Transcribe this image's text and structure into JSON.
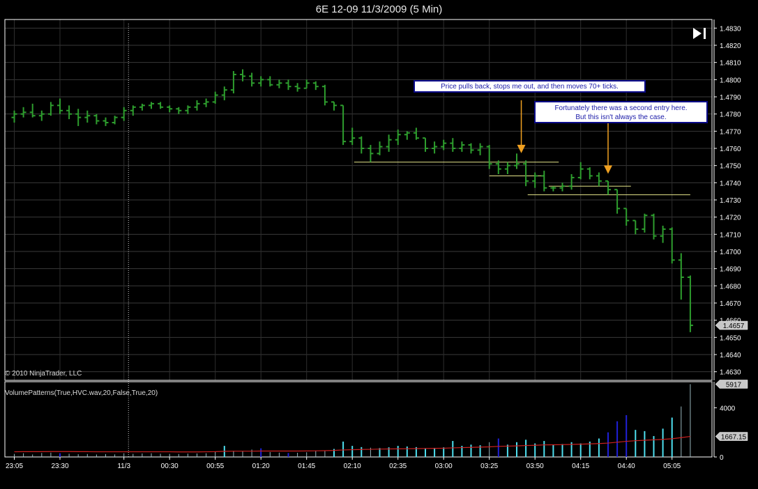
{
  "window": {
    "title": "6E 12-09  11/3/2009 (5 Min)"
  },
  "copyright": "© 2010 NinjaTrader, LLC",
  "indicator_label": "VolumePatterns(True,HVC.wav,20,False,True,20)",
  "annotations": [
    {
      "text": "Price pulls back, stops me out, and then moves 70+ ticks."
    },
    {
      "text": "Fortunately there was a second entry here.\nBut this isn't always the case."
    }
  ],
  "colors": {
    "price_bar": "#2e9e2e",
    "level_line": "#e6e68a",
    "volume_high": "#4ee0f0",
    "volume_low": "#2020d8",
    "volume_avg": "#cc2020",
    "arrow": "#f0a020"
  },
  "icons": {
    "nav": "skip-to-end-icon"
  },
  "chart_data": [
    {
      "type": "ohlc",
      "ylim": [
        1.4625,
        1.4835
      ],
      "yticks": [
        "1.4830",
        "1.4820",
        "1.4810",
        "1.4800",
        "1.4790",
        "1.4780",
        "1.4770",
        "1.4760",
        "1.4750",
        "1.4740",
        "1.4730",
        "1.4720",
        "1.4710",
        "1.4700",
        "1.4690",
        "1.4680",
        "1.4670",
        "1.4660",
        "1.4650",
        "1.4640",
        "1.4630"
      ],
      "last_price_label": "1.4657",
      "xticks": [
        {
          "label": "23:05",
          "i": 0
        },
        {
          "label": "23:30",
          "i": 5
        },
        {
          "label": "11/3",
          "i": 12
        },
        {
          "label": "00:30",
          "i": 17
        },
        {
          "label": "00:55",
          "i": 22
        },
        {
          "label": "01:20",
          "i": 27
        },
        {
          "label": "01:45",
          "i": 32
        },
        {
          "label": "02:10",
          "i": 37
        },
        {
          "label": "02:35",
          "i": 42
        },
        {
          "label": "03:00",
          "i": 47
        },
        {
          "label": "03:25",
          "i": 52
        },
        {
          "label": "03:50",
          "i": 57
        },
        {
          "label": "04:15",
          "i": 62
        },
        {
          "label": "04:40",
          "i": 67
        },
        {
          "label": "05:05",
          "i": 72
        }
      ],
      "session_break_index": 12.5,
      "bars": [
        [
          1.4778,
          1.4782,
          1.4775,
          1.478
        ],
        [
          1.478,
          1.4784,
          1.4778,
          1.4781
        ],
        [
          1.4781,
          1.4786,
          1.4778,
          1.4779
        ],
        [
          1.4779,
          1.4782,
          1.4776,
          1.478
        ],
        [
          1.478,
          1.4787,
          1.4779,
          1.4785
        ],
        [
          1.4785,
          1.4789,
          1.478,
          1.4782
        ],
        [
          1.4782,
          1.4785,
          1.4777,
          1.478
        ],
        [
          1.478,
          1.4783,
          1.4773,
          1.4778
        ],
        [
          1.4778,
          1.4782,
          1.4775,
          1.4779
        ],
        [
          1.4779,
          1.478,
          1.4774,
          1.4776
        ],
        [
          1.4776,
          1.4778,
          1.4773,
          1.4775
        ],
        [
          1.4775,
          1.4779,
          1.4774,
          1.4778
        ],
        [
          1.4778,
          1.4784,
          1.4776,
          1.4782
        ],
        [
          1.4782,
          1.4785,
          1.4779,
          1.4784
        ],
        [
          1.4784,
          1.4786,
          1.4782,
          1.4785
        ],
        [
          1.4785,
          1.4787,
          1.4783,
          1.4786
        ],
        [
          1.4786,
          1.4787,
          1.4783,
          1.4784
        ],
        [
          1.4784,
          1.4785,
          1.4781,
          1.4783
        ],
        [
          1.4783,
          1.4784,
          1.478,
          1.4782
        ],
        [
          1.4782,
          1.4785,
          1.478,
          1.4784
        ],
        [
          1.4784,
          1.4788,
          1.4782,
          1.4786
        ],
        [
          1.4786,
          1.4789,
          1.4784,
          1.4787
        ],
        [
          1.4787,
          1.4793,
          1.4786,
          1.4791
        ],
        [
          1.4791,
          1.4796,
          1.4788,
          1.4794
        ],
        [
          1.4794,
          1.4805,
          1.4792,
          1.4803
        ],
        [
          1.4803,
          1.4806,
          1.4799,
          1.4802
        ],
        [
          1.4802,
          1.4804,
          1.4796,
          1.4798
        ],
        [
          1.4798,
          1.4802,
          1.4796,
          1.48
        ],
        [
          1.48,
          1.4802,
          1.4796,
          1.4797
        ],
        [
          1.4797,
          1.48,
          1.4795,
          1.4798
        ],
        [
          1.4798,
          1.48,
          1.4794,
          1.4796
        ],
        [
          1.4796,
          1.4798,
          1.4793,
          1.4795
        ],
        [
          1.4795,
          1.48,
          1.4795,
          1.4798
        ],
        [
          1.4798,
          1.4799,
          1.4794,
          1.4796
        ],
        [
          1.4796,
          1.4797,
          1.4785,
          1.4787
        ],
        [
          1.4787,
          1.4787,
          1.4782,
          1.4785
        ],
        [
          1.4785,
          1.4785,
          1.4762,
          1.4764
        ],
        [
          1.4764,
          1.4772,
          1.4762,
          1.4766
        ],
        [
          1.4766,
          1.4767,
          1.4757,
          1.476
        ],
        [
          1.476,
          1.4762,
          1.4752,
          1.4757
        ],
        [
          1.4757,
          1.4764,
          1.4756,
          1.4761
        ],
        [
          1.4761,
          1.4768,
          1.4758,
          1.4765
        ],
        [
          1.4765,
          1.4771,
          1.4762,
          1.4768
        ],
        [
          1.4768,
          1.477,
          1.4765,
          1.4769
        ],
        [
          1.4769,
          1.4772,
          1.4765,
          1.4766
        ],
        [
          1.4766,
          1.4766,
          1.4758,
          1.476
        ],
        [
          1.476,
          1.4764,
          1.4757,
          1.4761
        ],
        [
          1.4761,
          1.4765,
          1.4759,
          1.4763
        ],
        [
          1.4763,
          1.4766,
          1.4758,
          1.476
        ],
        [
          1.476,
          1.4764,
          1.4758,
          1.4762
        ],
        [
          1.4762,
          1.4763,
          1.4757,
          1.4759
        ],
        [
          1.4759,
          1.4763,
          1.4756,
          1.4761
        ],
        [
          1.4761,
          1.4762,
          1.4748,
          1.4751
        ],
        [
          1.4751,
          1.4753,
          1.4745,
          1.4748
        ],
        [
          1.4748,
          1.4752,
          1.4745,
          1.475
        ],
        [
          1.475,
          1.4757,
          1.4748,
          1.4751
        ],
        [
          1.4751,
          1.4753,
          1.4738,
          1.4741
        ],
        [
          1.4741,
          1.4746,
          1.4737,
          1.4744
        ],
        [
          1.4744,
          1.4747,
          1.4735,
          1.4737
        ],
        [
          1.4737,
          1.4738,
          1.4735,
          1.4737
        ],
        [
          1.4737,
          1.474,
          1.4735,
          1.4738
        ],
        [
          1.4738,
          1.4745,
          1.4736,
          1.4743
        ],
        [
          1.4743,
          1.4752,
          1.4742,
          1.4748
        ],
        [
          1.4748,
          1.4749,
          1.4742,
          1.4744
        ],
        [
          1.4744,
          1.4746,
          1.4738,
          1.4741
        ],
        [
          1.4741,
          1.4741,
          1.4733,
          1.4736
        ],
        [
          1.4736,
          1.4736,
          1.4722,
          1.4725
        ],
        [
          1.4725,
          1.4725,
          1.4715,
          1.4718
        ],
        [
          1.4718,
          1.4718,
          1.471,
          1.4713
        ],
        [
          1.4713,
          1.4722,
          1.4711,
          1.4721
        ],
        [
          1.4721,
          1.4722,
          1.4707,
          1.4709
        ],
        [
          1.4709,
          1.4715,
          1.4705,
          1.4713
        ],
        [
          1.4713,
          1.4714,
          1.4693,
          1.4695
        ],
        [
          1.4695,
          1.4699,
          1.4672,
          1.4685
        ],
        [
          1.4685,
          1.4686,
          1.4653,
          1.4657
        ]
      ],
      "levels": [
        {
          "price": 1.4752,
          "from_i": 37.2,
          "to_i": 59.6
        },
        {
          "price": 1.4744,
          "from_i": 52.0,
          "to_i": 58.0
        },
        {
          "price": 1.4738,
          "from_i": 58.5,
          "to_i": 67.5
        },
        {
          "price": 1.4733,
          "from_i": 56.2,
          "to_i": 74.0
        }
      ],
      "arrows": [
        {
          "i": 55.5,
          "from_price": 1.4788,
          "to_price": 1.4758
        },
        {
          "i": 65.0,
          "from_price": 1.4776,
          "to_price": 1.4746
        }
      ]
    },
    {
      "type": "bar",
      "ylim": [
        0,
        6000
      ],
      "yticks": [
        "4000",
        "0"
      ],
      "last_value_label": "5917",
      "avg_label": "1667.15",
      "volumes": [
        250,
        300,
        200,
        320,
        350,
        300,
        260,
        220,
        240,
        200,
        230,
        210,
        300,
        250,
        280,
        300,
        260,
        250,
        240,
        270,
        280,
        300,
        420,
        900,
        500,
        480,
        600,
        700,
        400,
        350,
        320,
        340,
        380,
        500,
        480,
        650,
        1250,
        900,
        800,
        750,
        720,
        780,
        900,
        850,
        800,
        700,
        740,
        780,
        1300,
        900,
        1000,
        950,
        1200,
        1500,
        1000,
        1200,
        1400,
        1100,
        1300,
        1000,
        1050,
        1200,
        1100,
        1250,
        1500,
        2000,
        2900,
        3400,
        2200,
        2100,
        1700,
        2300,
        3200,
        4100,
        5917
      ],
      "high_indices": [
        23,
        35,
        36,
        37,
        38,
        40,
        41,
        42,
        43,
        44,
        45,
        46,
        47,
        48,
        49,
        50,
        51,
        54,
        55,
        56,
        57,
        58,
        59,
        60,
        61,
        62,
        63,
        64,
        68,
        69,
        70,
        71,
        72
      ],
      "low_indices": [
        5,
        27,
        30,
        53,
        65,
        66,
        67
      ],
      "avg": [
        420,
        430,
        430,
        430,
        440,
        440,
        440,
        430,
        430,
        420,
        420,
        420,
        420,
        420,
        420,
        420,
        420,
        420,
        410,
        410,
        410,
        420,
        430,
        460,
        470,
        470,
        470,
        480,
        480,
        480,
        480,
        480,
        490,
        500,
        510,
        530,
        570,
        590,
        610,
        620,
        640,
        650,
        660,
        670,
        680,
        690,
        700,
        710,
        740,
        760,
        780,
        800,
        820,
        860,
        880,
        900,
        930,
        950,
        980,
        990,
        1000,
        1020,
        1040,
        1060,
        1090,
        1130,
        1200,
        1270,
        1320,
        1360,
        1390,
        1430,
        1480,
        1570,
        1667
      ]
    }
  ]
}
